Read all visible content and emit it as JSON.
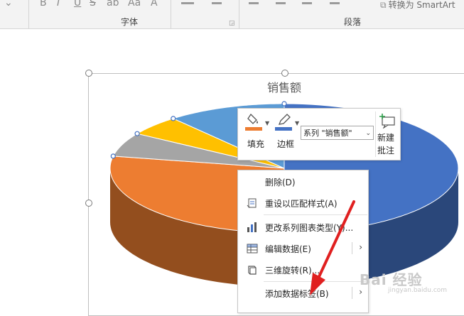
{
  "ribbon": {
    "font_group_label": "字体",
    "paragraph_group_label": "段落",
    "smartart_label": "转换为 SmartArt"
  },
  "chart": {
    "title": "销售额",
    "accent_colors": [
      "#4472c4",
      "#ed7d31",
      "#a5a5a5",
      "#ffc000",
      "#5b9bd5"
    ]
  },
  "chart_data": {
    "type": "pie",
    "title": "销售额",
    "series": [
      {
        "name": "销售额",
        "values": [
          50,
          28,
          6,
          5,
          11
        ]
      }
    ],
    "categories": [],
    "colors": [
      "#4472c4",
      "#ed7d31",
      "#a5a5a5",
      "#ffc000",
      "#5b9bd5"
    ],
    "style": "3d-pie",
    "legend": "none"
  },
  "mini_toolbar": {
    "fill_label": "填充",
    "outline_label": "边框",
    "fill_color": "#ed7d31",
    "outline_color": "#4472c4",
    "series_selector_value": "系列 \"销售额\"",
    "new_comment_label_1": "新建",
    "new_comment_label_2": "批注"
  },
  "context_menu": {
    "items": [
      {
        "label": "删除(D)",
        "icon": "none"
      },
      {
        "label": "重设以匹配样式(A)",
        "icon": "reset-style-icon"
      },
      {
        "label": "更改系列图表类型(Y)...",
        "icon": "chart-type-icon"
      },
      {
        "label": "编辑数据(E)",
        "icon": "table-icon",
        "submenu": true
      },
      {
        "label": "三维旋转(R)...",
        "icon": "rotate-3d-icon"
      },
      {
        "label": "添加数据标签(B)",
        "icon": "none",
        "submenu": true
      }
    ]
  },
  "watermark": {
    "text": "Bai 经验",
    "sub": "jingyan.baidu.com"
  }
}
